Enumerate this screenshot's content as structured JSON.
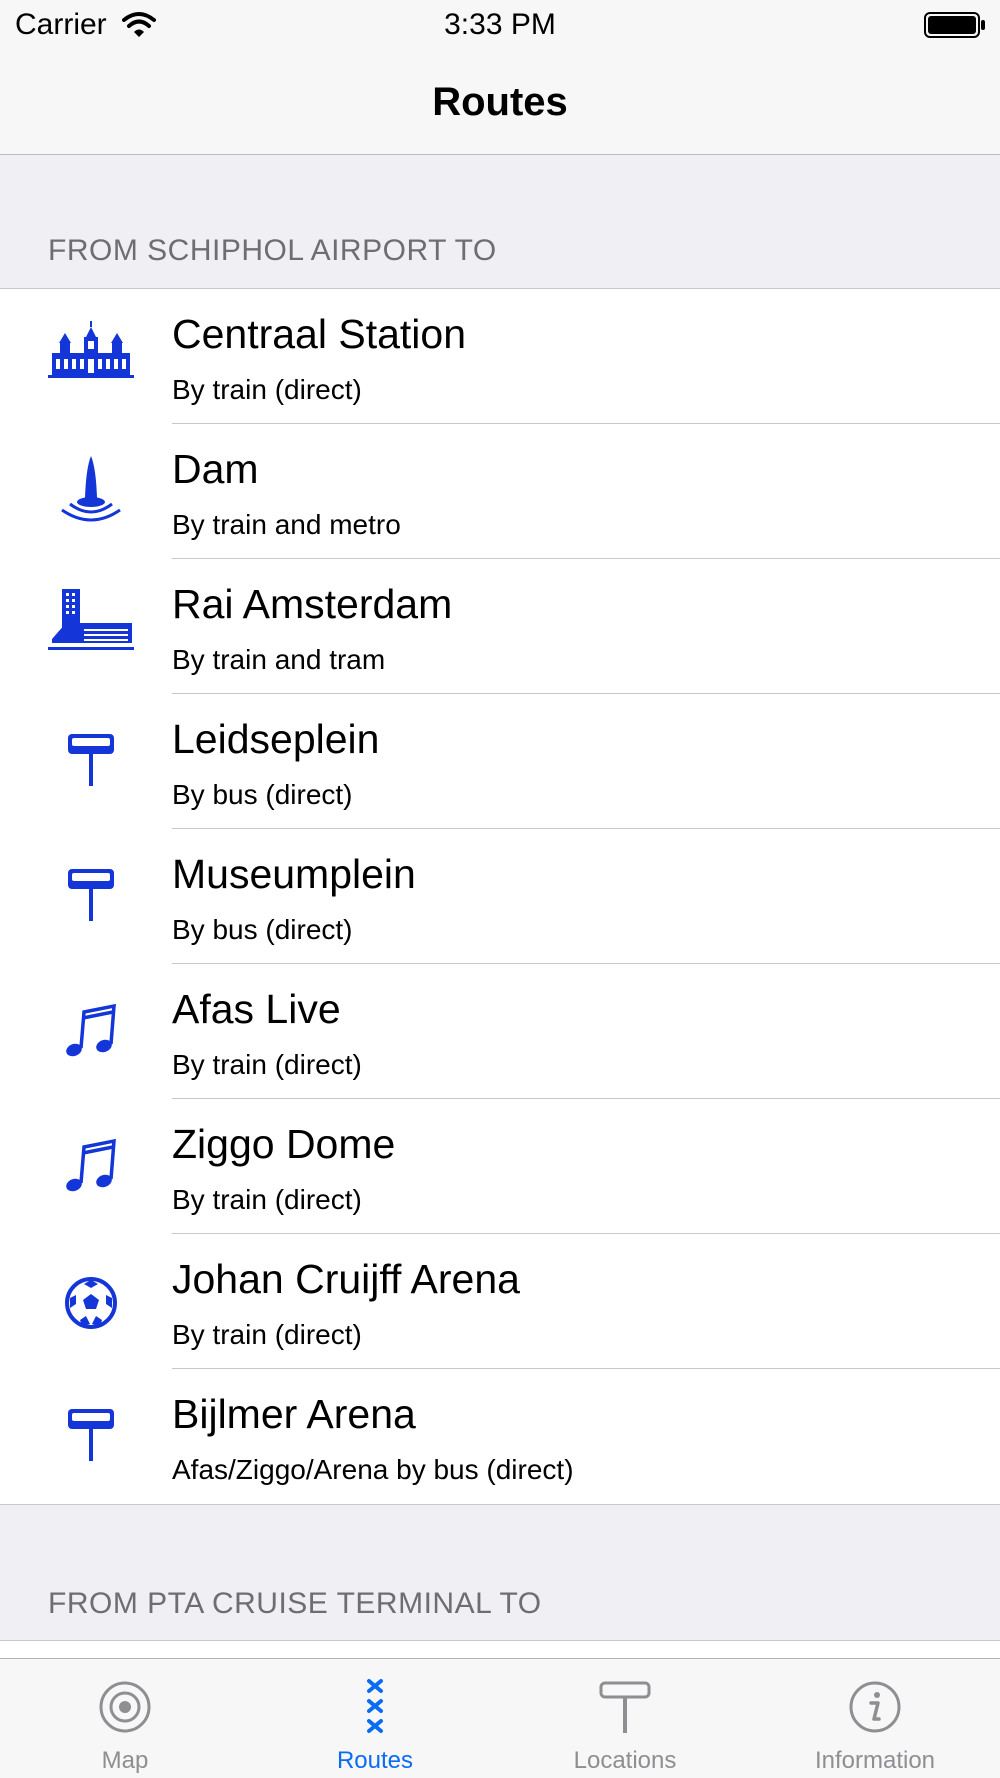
{
  "status": {
    "carrier": "Carrier",
    "time": "3:33 PM"
  },
  "nav": {
    "title": "Routes"
  },
  "colors": {
    "accent": "#0a6cf0",
    "icon_blue": "#1436d8",
    "section_text": "#6d6d72"
  },
  "sections": [
    {
      "header": "FROM SCHIPHOL AIRPORT TO",
      "rows": [
        {
          "icon": "station-building-icon",
          "title": "Centraal Station",
          "subtitle": "By train (direct)"
        },
        {
          "icon": "monument-icon",
          "title": "Dam",
          "subtitle": "By train and metro"
        },
        {
          "icon": "convention-center-icon",
          "title": "Rai Amsterdam",
          "subtitle": "By train and tram"
        },
        {
          "icon": "signpost-icon",
          "title": "Leidseplein",
          "subtitle": "By bus (direct)"
        },
        {
          "icon": "signpost-icon",
          "title": "Museumplein",
          "subtitle": "By bus (direct)"
        },
        {
          "icon": "music-note-icon",
          "title": "Afas Live",
          "subtitle": "By train (direct)"
        },
        {
          "icon": "music-note-icon",
          "title": "Ziggo Dome",
          "subtitle": "By train (direct)"
        },
        {
          "icon": "soccer-ball-icon",
          "title": "Johan Cruijff Arena",
          "subtitle": "By train (direct)"
        },
        {
          "icon": "signpost-icon",
          "title": "Bijlmer Arena",
          "subtitle": "Afas/Ziggo/Arena by bus (direct)"
        }
      ]
    },
    {
      "header": "FROM PTA CRUISE TERMINAL TO"
    }
  ],
  "tabs": [
    {
      "icon": "target-icon",
      "label": "Map"
    },
    {
      "icon": "triple-x-icon",
      "label": "Routes",
      "selected": true
    },
    {
      "icon": "signpost-icon",
      "label": "Locations"
    },
    {
      "icon": "info-icon",
      "label": "Information"
    }
  ]
}
